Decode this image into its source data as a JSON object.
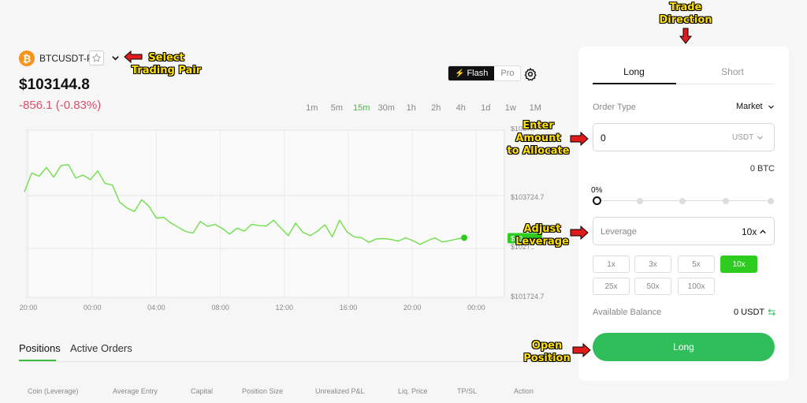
{
  "header": {
    "coin_symbol": "₿",
    "pair": "BTCUSDT-P",
    "price": "$103144.8",
    "change": "-856.1 (-0.83%)",
    "mode_flash": "Flash",
    "mode_pro": "Pro"
  },
  "timeframes": [
    "1m",
    "5m",
    "15m",
    "30m",
    "1h",
    "2h",
    "4h",
    "1d",
    "1w",
    "1M"
  ],
  "active_timeframe": "15m",
  "chart": {
    "y_labels": [
      "$1057..",
      "$103724.7",
      "$1027..",
      "$101724.7"
    ],
    "x_labels": [
      "20:00",
      "00:00",
      "04:00",
      "08:00",
      "12:00",
      "16:00",
      "20:00",
      "00:00"
    ],
    "current_label": "$10..",
    "line_color": "#6fe04a",
    "current_marker_color": "#2ecc1e"
  },
  "chart_data": {
    "type": "line",
    "series": [
      {
        "values": [
          104250,
          104700,
          104620,
          104830,
          104600,
          104880,
          104900,
          104580,
          104650,
          104540,
          104750,
          104450,
          104410,
          104000,
          103860,
          103780,
          104060,
          103900,
          103620,
          103640,
          103500,
          103400,
          103300,
          103260,
          103540,
          103420,
          103470,
          103370,
          103240,
          103380,
          103310,
          103470,
          103440,
          103430,
          103570,
          103380,
          103200,
          103500,
          103280,
          103200,
          103310,
          103460,
          103170,
          103570,
          103290,
          103170,
          103150,
          103040,
          103120,
          103130,
          103110,
          103070,
          103150,
          103080,
          102990,
          103080,
          103150,
          103050,
          103080,
          103120,
          103150
        ]
      }
    ],
    "x_ticks": [
      "20:00",
      "00:00",
      "04:00",
      "08:00",
      "12:00",
      "16:00",
      "20:00",
      "00:00"
    ],
    "ylim": [
      101724.7,
      105724.7
    ],
    "grid": true
  },
  "positions": {
    "tab_positions": "Positions",
    "tab_orders": "Active Orders",
    "columns": [
      "Coin (Leverage)",
      "Average Entry",
      "Capital",
      "Position Size",
      "Unrealized P&L",
      "Liq. Price",
      "TP/SL",
      "Action"
    ]
  },
  "trade": {
    "tab_long": "Long",
    "tab_short": "Short",
    "order_type_label": "Order Type",
    "order_type_value": "Market",
    "amount_value": "0",
    "amount_unit": "USDT",
    "btc_amount": "0 BTC",
    "slider_percent": "0%",
    "slider_value": 0,
    "leverage_label": "Leverage",
    "leverage_value": "10x",
    "leverage_options": [
      "1x",
      "3x",
      "5x",
      "10x",
      "25x",
      "50x",
      "100x"
    ],
    "leverage_active": "10x",
    "balance_label": "Available Balance",
    "balance_value": "0 USDT",
    "long_button": "Long"
  },
  "annotations": {
    "select_pair": "Select\nTrading Pair",
    "trade_direction": "Trade\nDirection",
    "enter_amount": "Enter\nAmount\nto Allocate",
    "adjust_leverage": "Adjust\nLeverage",
    "open_position": "Open\nPosition"
  },
  "colors": {
    "accent_green": "#2ecc1e",
    "long_button": "#2fbe5a",
    "negative": "#d9506a",
    "annotation_text": "#ffe000",
    "annotation_arrow": "#e01b1b"
  }
}
